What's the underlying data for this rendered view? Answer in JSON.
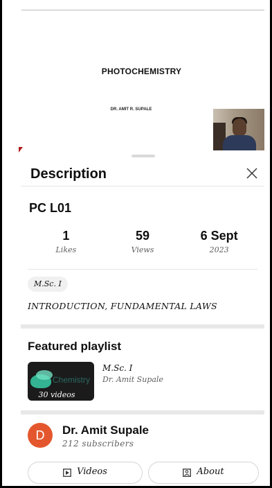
{
  "video": {
    "slide_title": "PHOTOCHEMISTRY",
    "slide_author": "DR. AMIT R. SUPALE"
  },
  "sheet": {
    "title": "Description",
    "close_icon": "close-icon"
  },
  "details": {
    "video_title": "PC L01",
    "stats": [
      {
        "value": "1",
        "label": "Likes"
      },
      {
        "value": "59",
        "label": "Views"
      },
      {
        "value": "6 Sept",
        "label": "2023"
      }
    ],
    "tag": "M.Sc. I",
    "description": "INTRODUCTION, FUNDAMENTAL LAWS"
  },
  "playlist": {
    "heading": "Featured playlist",
    "thumb_text": "Chemistry",
    "count": "30 videos",
    "name": "M.Sc. I",
    "owner": "Dr. Amit Supale"
  },
  "channel": {
    "avatar_letter": "D",
    "avatar_color": "#e4572e",
    "name": "Dr. Amit Supale",
    "subscribers": "212 subscribers",
    "buttons": [
      {
        "label": "Videos",
        "icon": "play-icon"
      },
      {
        "label": "About",
        "icon": "person-icon"
      }
    ]
  }
}
